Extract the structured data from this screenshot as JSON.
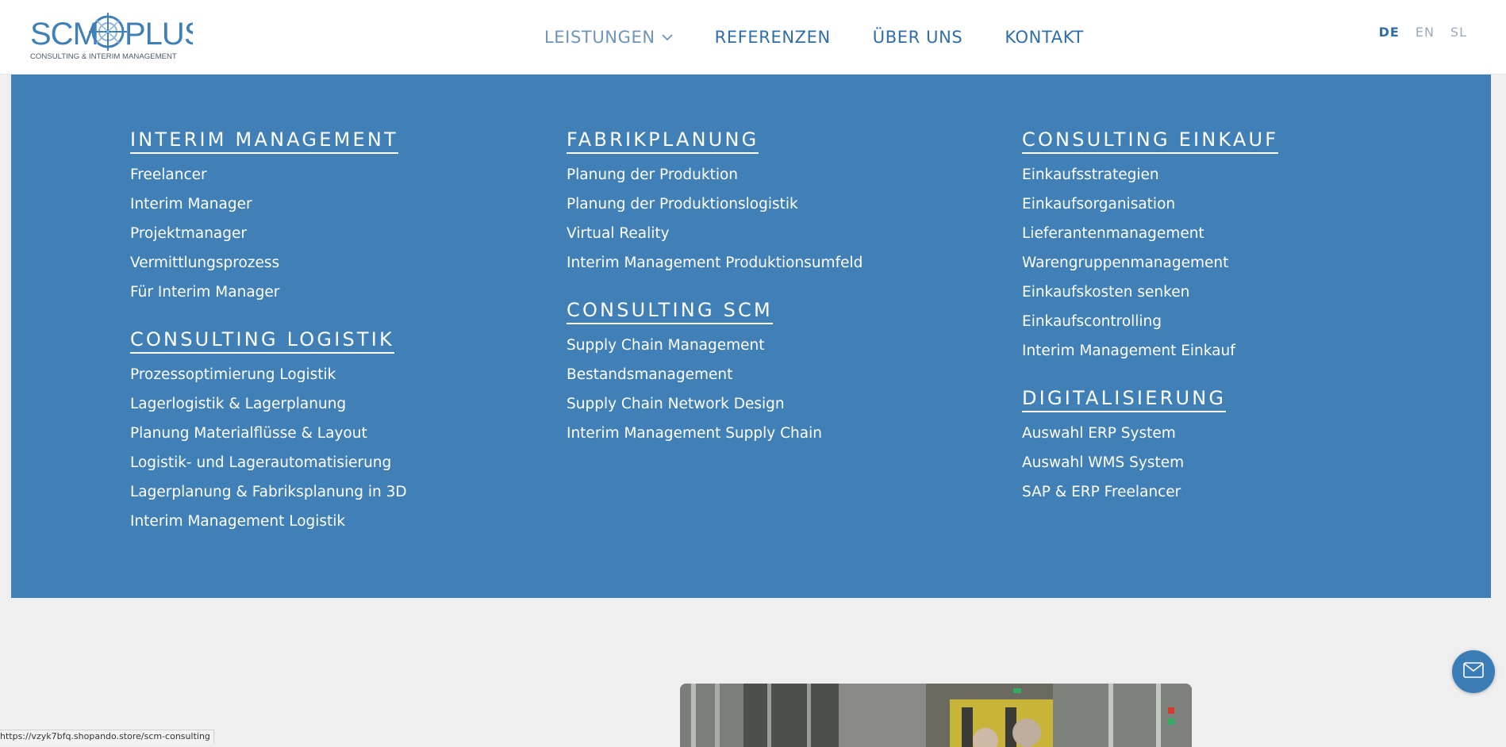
{
  "brand": {
    "logo_text": "SCM PLUS",
    "tagline": "CONSULTING & INTERIM MANAGEMENT",
    "color": "#4080b7"
  },
  "nav": {
    "items": [
      {
        "label": "LEISTUNGEN",
        "icon": "chevron-down-icon",
        "active": true
      },
      {
        "label": "REFERENZEN"
      },
      {
        "label": "ÜBER UNS"
      },
      {
        "label": "KONTAKT"
      }
    ]
  },
  "languages": {
    "items": [
      "DE",
      "EN",
      "SL"
    ],
    "active": "DE"
  },
  "mega_menu": {
    "background": "#4080b7",
    "columns": [
      {
        "groups": [
          {
            "title": "INTERIM MANAGEMENT",
            "links": [
              "Freelancer",
              "Interim Manager",
              "Projektmanager",
              "Vermittlungsprozess",
              "Für Interim Manager"
            ]
          },
          {
            "title": "CONSULTING LOGISTIK",
            "links": [
              "Prozessoptimierung Logistik",
              "Lagerlogistik & Lagerplanung",
              "Planung Materialflüsse & Layout",
              "Logistik- und Lagerautomatisierung",
              "Lagerplanung & Fabriksplanung in 3D",
              "Interim Management Logistik"
            ]
          }
        ]
      },
      {
        "groups": [
          {
            "title": "FABRIKPLANUNG",
            "links": [
              "Planung der Produktion",
              "Planung der Produktionslogistik",
              "Virtual Reality",
              "Interim Management Produktionsumfeld"
            ]
          },
          {
            "title": "CONSULTING SCM",
            "links": [
              "Supply Chain Management",
              "Bestandsmanagement",
              "Supply Chain Network Design",
              "Interim Management Supply Chain"
            ]
          }
        ]
      },
      {
        "groups": [
          {
            "title": "CONSULTING EINKAUF",
            "links": [
              "Einkaufsstrategien",
              "Einkaufsorganisation",
              "Lieferantenmanagement",
              "Warengruppenmanagement",
              "Einkaufskosten senken",
              "Einkaufscontrolling",
              "Interim Management Einkauf"
            ]
          },
          {
            "title": "DIGITALISIERUNG",
            "links": [
              "Auswahl ERP System",
              "Auswahl WMS System",
              "SAP & ERP Freelancer"
            ]
          }
        ]
      }
    ]
  },
  "floating": {
    "mail_icon": "envelope-icon"
  },
  "status_bar": {
    "url": "https://vzyk7bfq.shopando.store/scm-consulting"
  }
}
